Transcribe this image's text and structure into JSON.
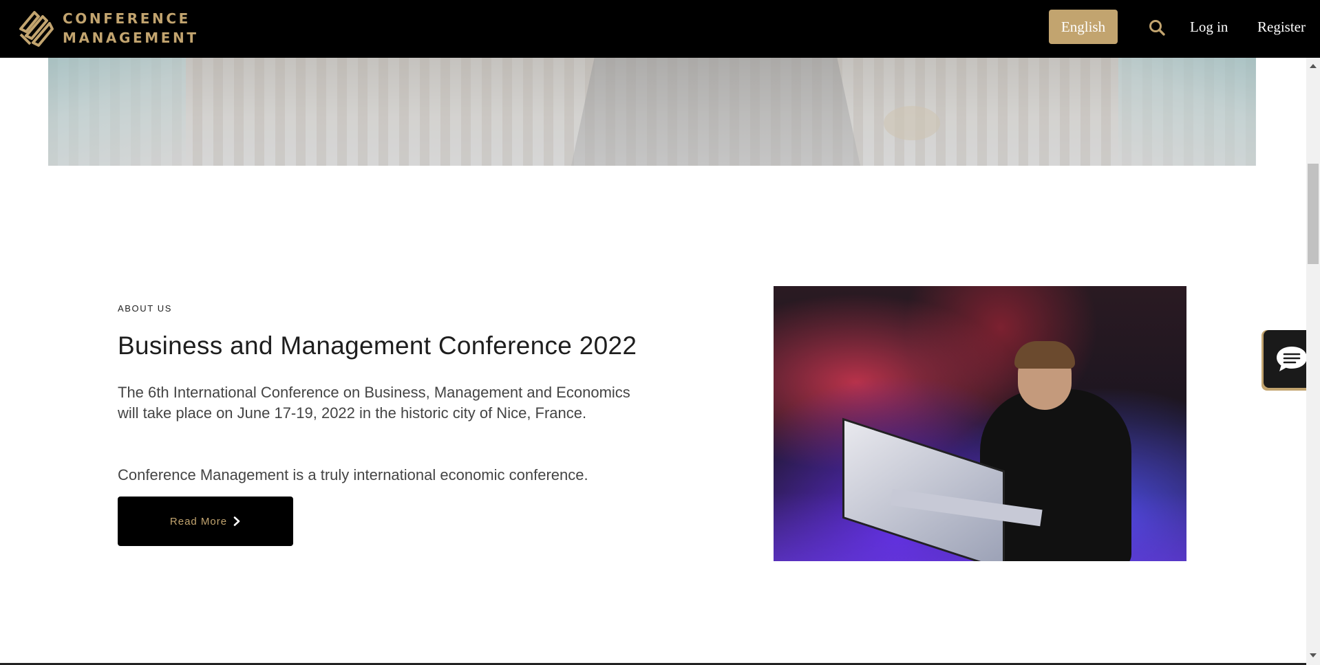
{
  "header": {
    "brand_line1": "CONFERENCE",
    "brand_line2": "MANAGEMENT",
    "language_button": "English",
    "login_label": "Log in",
    "register_label": "Register",
    "accent_color": "#c2a46f"
  },
  "about": {
    "kicker": "ABOUT US",
    "title": "Business and Management Conference 2022",
    "paragraph1": "The 6th International Conference on Business, Management and Economics will take place on June 17-19, 2022 in the historic city of Nice, France.",
    "paragraph2": "Conference Management is a truly international economic conference.",
    "read_more_label": "Read More"
  },
  "icons": {
    "logo": "logo-icon",
    "search": "search-icon",
    "chevron": "chevron-right-icon",
    "chat": "chat-icon"
  }
}
